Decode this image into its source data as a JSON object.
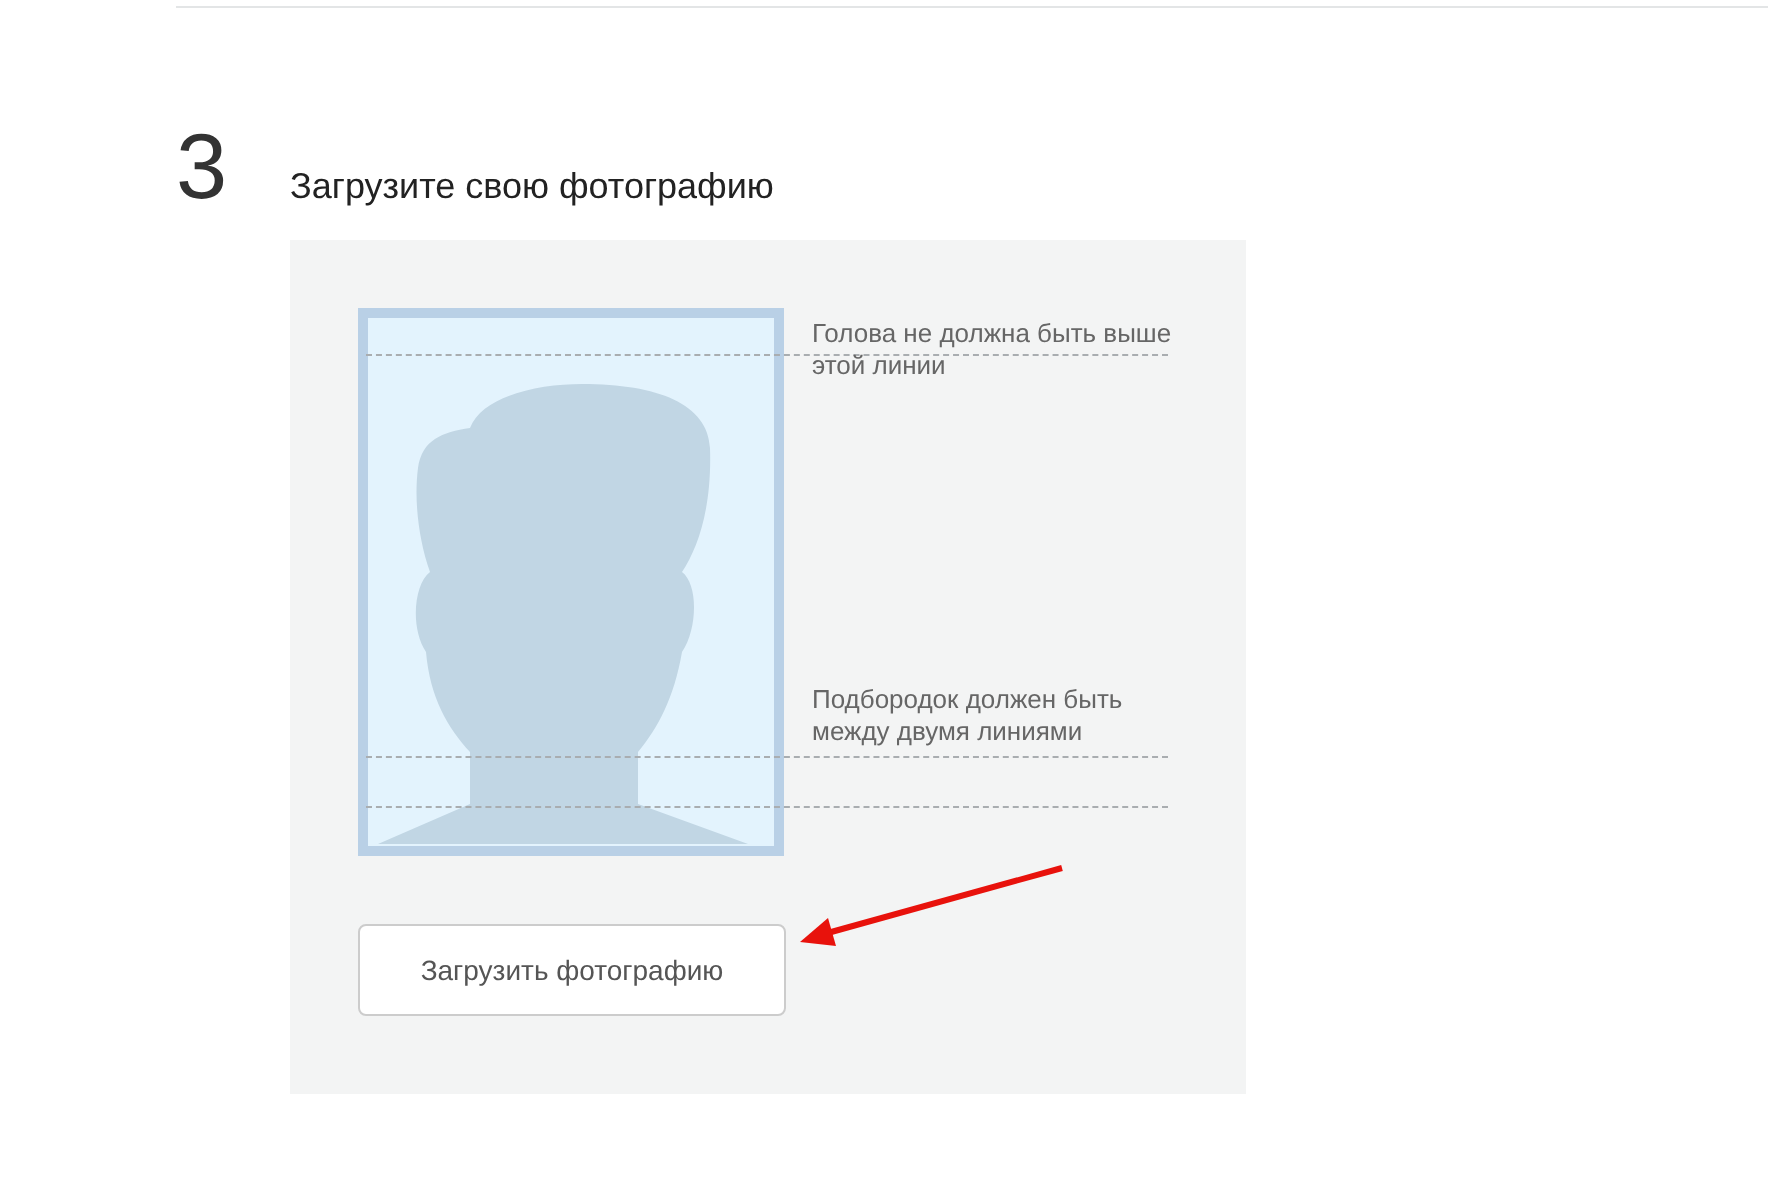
{
  "step": {
    "number": "3",
    "title": "Загрузите свою фотографию"
  },
  "guides": [
    {
      "kind": "top",
      "hint": "Голова не должна быть выше этой линии"
    },
    {
      "kind": "chin",
      "hint": "Подбородок должен быть между двумя линиями"
    }
  ],
  "upload_button": {
    "label": "Загрузить фотографию"
  }
}
